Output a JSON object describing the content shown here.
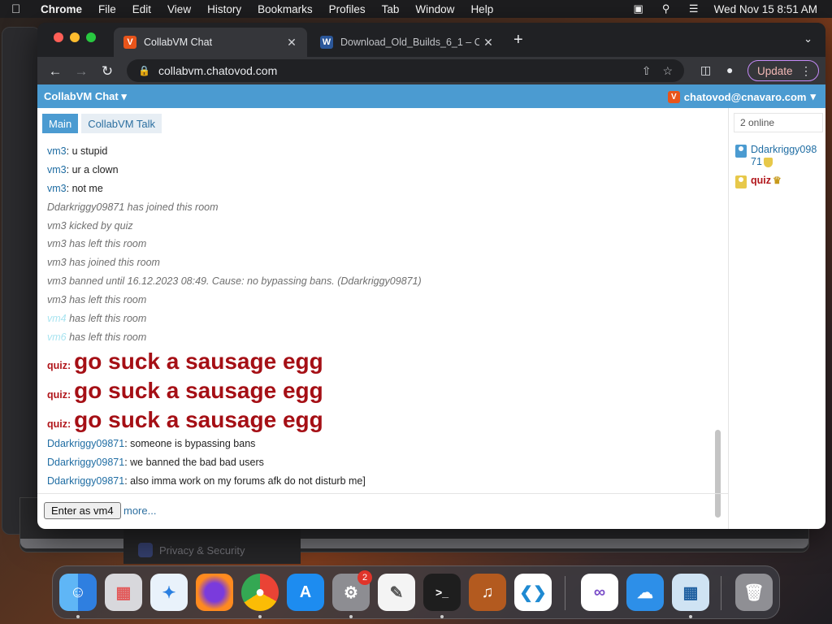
{
  "menubar": {
    "app_name": "Chrome",
    "items": [
      "File",
      "Edit",
      "View",
      "History",
      "Bookmarks",
      "Profiles",
      "Tab",
      "Window",
      "Help"
    ],
    "clock": "Wed Nov 15  8:51 AM"
  },
  "background": {
    "settings_item": "Privacy & Security"
  },
  "browser": {
    "tabs": [
      {
        "title": "CollabVM Chat"
      },
      {
        "title": "Download_Old_Builds_6_1 – C"
      }
    ],
    "url": "collabvm.chatovod.com",
    "update_label": "Update"
  },
  "chat": {
    "brand": "CollabVM Chat",
    "current_user": "chatovod@cnavaro.com",
    "tabs": [
      "Main",
      "CollabVM Talk"
    ],
    "messages": [
      {
        "nick": "vm3",
        "text": ": u stupid"
      },
      {
        "nick": "vm3",
        "text": ": ur a clown"
      },
      {
        "nick": "vm3",
        "text": ": not me"
      },
      {
        "system": "Ddarkriggy09871 has joined this room"
      },
      {
        "system": "vm3 kicked by quiz"
      },
      {
        "system": "vm3 has left this room"
      },
      {
        "system": "vm3 has joined this room"
      },
      {
        "system": "vm3 banned until 16.12.2023 08:49. Cause: no bypassing bans. (Ddarkriggy09871)"
      },
      {
        "system": "vm3 has left this room"
      },
      {
        "faint_nick": "vm4",
        "system": " has left this room"
      },
      {
        "faint_nick": "vm6",
        "system": " has left this room"
      },
      {
        "nick": "quiz",
        "big": "go suck a sausage egg"
      },
      {
        "nick": "quiz",
        "big": "go suck a sausage egg"
      },
      {
        "nick": "quiz",
        "big": "go suck a sausage egg"
      },
      {
        "nick": "Ddarkriggy09871",
        "text": ": someone is bypassing bans"
      },
      {
        "nick": "Ddarkriggy09871",
        "text": ": we banned the bad bad users"
      },
      {
        "nick": "Ddarkriggy09871",
        "text": ": also imma work on my forums afk do not disturb me]"
      }
    ],
    "enter_button": "Enter as vm4",
    "more_link": "more...",
    "online_count": "2 online",
    "users": [
      {
        "name": "Ddarkriggy09871"
      },
      {
        "name": "quiz"
      }
    ],
    "colors": {
      "accent": "#4b9bd1",
      "nick": "#1f6da3",
      "admin": "#b1161b"
    }
  },
  "dock": {
    "apps": [
      "Finder",
      "Launchpad",
      "Safari",
      "Firefox",
      "Chrome",
      "App Store",
      "System Settings",
      "TextEdit",
      "Terminal",
      "GarageBand",
      "Visual Studio Code",
      "Visual Studio",
      "Weather",
      "VirtualBox",
      "Trash"
    ],
    "settings_badge": "2"
  }
}
